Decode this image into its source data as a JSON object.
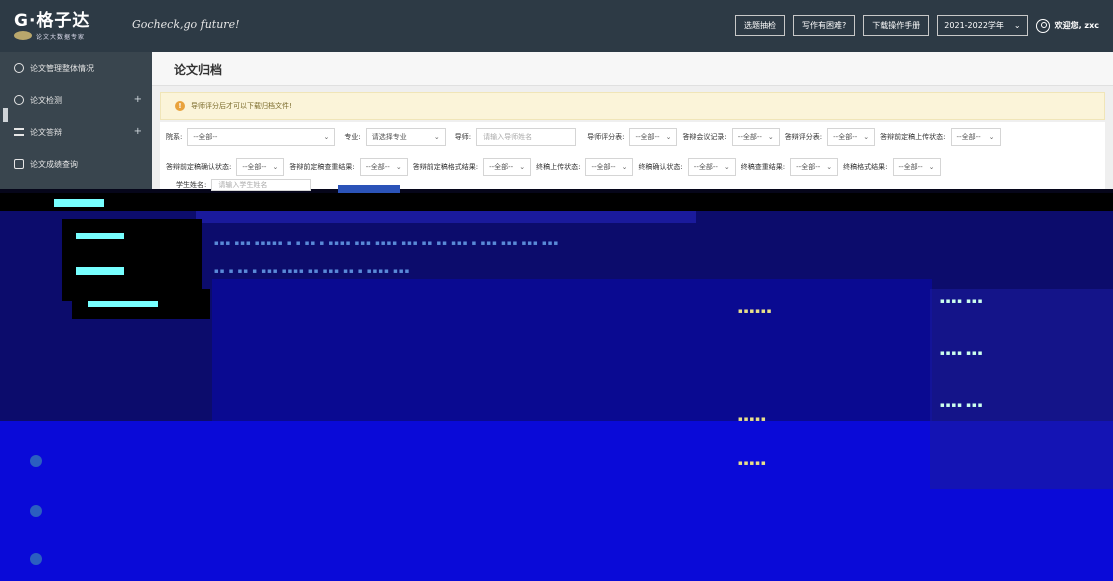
{
  "header": {
    "logo_text": "G·格子达",
    "logo_sub": "论文大数据专家",
    "slogan": "Gocheck,go future!",
    "buttons": [
      "选题抽检",
      "写作有困难?",
      "下载操作手册"
    ],
    "year_select": "2021-2022学年",
    "welcome": "欢迎您, zxc"
  },
  "sidebar": {
    "items": [
      {
        "label": "论文管理整体情况",
        "icon": "layers-icon",
        "expand": ""
      },
      {
        "label": "论文检测",
        "icon": "clock-icon",
        "expand": "+"
      },
      {
        "label": "论文答辩",
        "icon": "list-edit-icon",
        "expand": "+"
      },
      {
        "label": "论文成绩查询",
        "icon": "grade-icon",
        "expand": ""
      }
    ]
  },
  "main": {
    "title": "论文归档",
    "notice": "导师评分后才可以下载归档文件!",
    "filters": {
      "row1": [
        {
          "label": "院系:",
          "value": "--全部--"
        },
        {
          "label": "专业:",
          "value": "请选择专业"
        },
        {
          "label": "导师:",
          "placeholder": "请输入导师姓名"
        },
        {
          "label": "导师评分表:",
          "value": "--全部--"
        },
        {
          "label": "答辩会议记录:",
          "value": "--全部--"
        },
        {
          "label": "答辩评分表:",
          "value": "--全部--"
        },
        {
          "label": "答辩前定稿上传状态:",
          "value": "--全部--"
        }
      ],
      "row2": [
        {
          "label": "答辩前定稿确认状态:",
          "value": "--全部--"
        },
        {
          "label": "答辩前定稿查重结果:",
          "value": "--全部--"
        },
        {
          "label": "答辩前定稿格式结果:",
          "value": "--全部--"
        },
        {
          "label": "终稿上传状态:",
          "value": "--全部--"
        },
        {
          "label": "终稿确认状态:",
          "value": "--全部--"
        },
        {
          "label": "终稿查重结果:",
          "value": "--全部--"
        },
        {
          "label": "终稿格式结果:",
          "value": "--全部--"
        }
      ],
      "student": {
        "label": "学生姓名:",
        "placeholder": "请输入学生姓名"
      }
    }
  },
  "colors": {
    "header_bg": "#2d3a45",
    "sidebar_bg": "#39454e",
    "accent": "#2b53b8",
    "glitch_blue": "#0a0ad8"
  }
}
